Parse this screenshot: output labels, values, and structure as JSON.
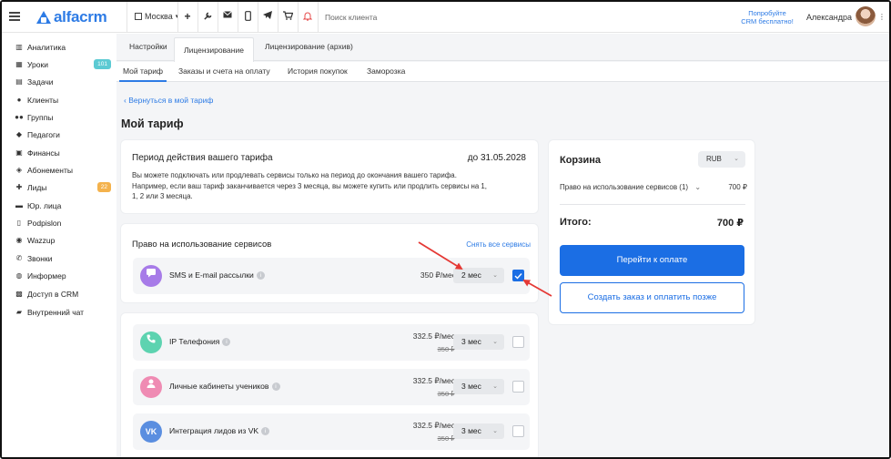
{
  "header": {
    "logo_text": "alfacrm",
    "branch": "Москва",
    "search_placeholder": "Поиск клиента",
    "promo_line1": "Попробуйте",
    "promo_line2": "CRM бесплатно!",
    "user_name": "Александра"
  },
  "sidebar": {
    "items": [
      {
        "label": "Аналитика",
        "icon": "chart-icon"
      },
      {
        "label": "Уроки",
        "icon": "calendar-icon",
        "badge": "101"
      },
      {
        "label": "Задачи",
        "icon": "clipboard-icon"
      },
      {
        "label": "Клиенты",
        "icon": "user-icon"
      },
      {
        "label": "Группы",
        "icon": "users-icon"
      },
      {
        "label": "Педагоги",
        "icon": "graduation-cap-icon"
      },
      {
        "label": "Финансы",
        "icon": "money-icon"
      },
      {
        "label": "Абонементы",
        "icon": "tag-icon"
      },
      {
        "label": "Лиды",
        "icon": "user-plus-icon",
        "badge": "22"
      },
      {
        "label": "Юр. лица",
        "icon": "briefcase-icon"
      },
      {
        "label": "Podpislon",
        "icon": "document-icon"
      },
      {
        "label": "Wazzup",
        "icon": "whatsapp-icon"
      },
      {
        "label": "Звонки",
        "icon": "phone-icon"
      },
      {
        "label": "Информер",
        "icon": "bell-icon"
      },
      {
        "label": "Доступ в CRM",
        "icon": "lock-icon"
      },
      {
        "label": "Внутренний чат",
        "icon": "chat-icon"
      }
    ]
  },
  "tabs_top": [
    "Настройки",
    "Лицензирование",
    "Лицензирование (архив)"
  ],
  "tabs_sub": [
    "Мой тариф",
    "Заказы и счета на оплату",
    "История покупок",
    "Заморозка"
  ],
  "back_link": "Вернуться в мой тариф",
  "page_title": "Мой тариф",
  "period": {
    "title": "Период действия вашего тарифа",
    "date": "до 31.05.2028",
    "text_line1": "Вы можете подключать или продлевать сервисы только на период до окончания вашего тарифа.",
    "text_line2": "Например, если ваш тариф заканчивается через 3 месяца, вы можете купить или продлить сервисы на 1,",
    "text_line3": "1, 2 или 3 месяца."
  },
  "services": {
    "title": "Право на использование сервисов",
    "remove_all": "Снять все сервисы",
    "selected": {
      "name": "SMS и E-mail рассылки",
      "price": "350 ₽/мес",
      "period": "2 мес",
      "checked": true
    },
    "others": [
      {
        "name": "IP Телефония",
        "price": "332.5 ₽/мес",
        "old_price": "350 ₽",
        "period": "3 мес",
        "color": "#5dd3b0"
      },
      {
        "name": "Личные кабинеты учеников",
        "price": "332.5 ₽/мес",
        "old_price": "350 ₽",
        "period": "3 мес",
        "color": "#ef8bb3"
      },
      {
        "name": "Интеграция лидов из VK",
        "price": "332.5 ₽/мес",
        "old_price": "350 ₽",
        "period": "3 мес",
        "color": "#5a8ee0"
      }
    ]
  },
  "cart": {
    "title": "Корзина",
    "currency": "RUB",
    "line_label": "Право на использование сервисов (1)",
    "line_amount": "700 ₽",
    "total_label": "Итого:",
    "total_value": "700 ₽",
    "pay_button": "Перейти к оплате",
    "order_button": "Создать заказ и оплатить позже"
  },
  "colors": {
    "accent": "#1b6ee4",
    "annotation_arrow": "#e53935",
    "sms_icon": "#a77be8"
  }
}
